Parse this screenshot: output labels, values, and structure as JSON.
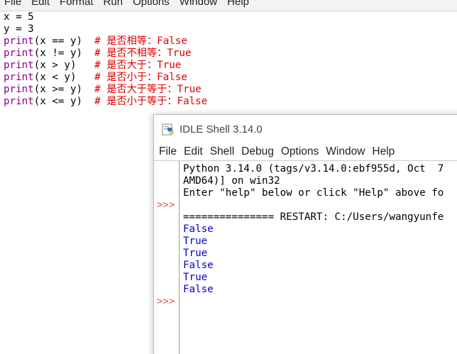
{
  "editor": {
    "menu": [
      "File",
      "Edit",
      "Format",
      "Run",
      "Options",
      "Window",
      "Help"
    ],
    "lines": [
      [
        {
          "t": "x = 5",
          "c": "plain"
        }
      ],
      [
        {
          "t": "y = 3",
          "c": "plain"
        }
      ],
      [
        {
          "t": "print",
          "c": "builtin"
        },
        {
          "t": "(x == y)  ",
          "c": "plain"
        },
        {
          "t": "# 是否相等：False",
          "c": "comment"
        }
      ],
      [
        {
          "t": "print",
          "c": "builtin"
        },
        {
          "t": "(x != y)  ",
          "c": "plain"
        },
        {
          "t": "# 是否不相等：True",
          "c": "comment"
        }
      ],
      [
        {
          "t": "print",
          "c": "builtin"
        },
        {
          "t": "(x > y)   ",
          "c": "plain"
        },
        {
          "t": "# 是否大于：True",
          "c": "comment"
        }
      ],
      [
        {
          "t": "print",
          "c": "builtin"
        },
        {
          "t": "(x < y)   ",
          "c": "plain"
        },
        {
          "t": "# 是否小于：False",
          "c": "comment"
        }
      ],
      [
        {
          "t": "print",
          "c": "builtin"
        },
        {
          "t": "(x >= y)  ",
          "c": "plain"
        },
        {
          "t": "# 是否大于等于：True",
          "c": "comment"
        }
      ],
      [
        {
          "t": "print",
          "c": "builtin"
        },
        {
          "t": "(x <= y)  ",
          "c": "plain"
        },
        {
          "t": "# 是否小于等于：False",
          "c": "comment"
        }
      ]
    ]
  },
  "shell": {
    "title": "IDLE Shell 3.14.0",
    "menu": [
      "File",
      "Edit",
      "Shell",
      "Debug",
      "Options",
      "Window",
      "Help"
    ],
    "prompt_symbol": ">>>",
    "lines": [
      {
        "t": "Python 3.14.0 (tags/v3.14.0:ebf955d, Oct  7",
        "c": "plain"
      },
      {
        "t": "AMD64)] on win32",
        "c": "plain"
      },
      {
        "t": "Enter \"help\" below or click \"Help\" above fo",
        "c": "plain"
      },
      {
        "t": "",
        "c": "plain"
      },
      {
        "t": "=============== RESTART: C:/Users/wangyunfe",
        "c": "plain"
      },
      {
        "t": "False",
        "c": "out"
      },
      {
        "t": "True",
        "c": "out"
      },
      {
        "t": "True",
        "c": "out"
      },
      {
        "t": "False",
        "c": "out"
      },
      {
        "t": "True",
        "c": "out"
      },
      {
        "t": "False",
        "c": "out"
      }
    ]
  },
  "icons": {
    "shell_icon": "python-idle-icon"
  },
  "colors": {
    "builtin": "#900090",
    "comment": "#dd0000",
    "output": "#0000cc",
    "prompt": "#dd5555"
  }
}
